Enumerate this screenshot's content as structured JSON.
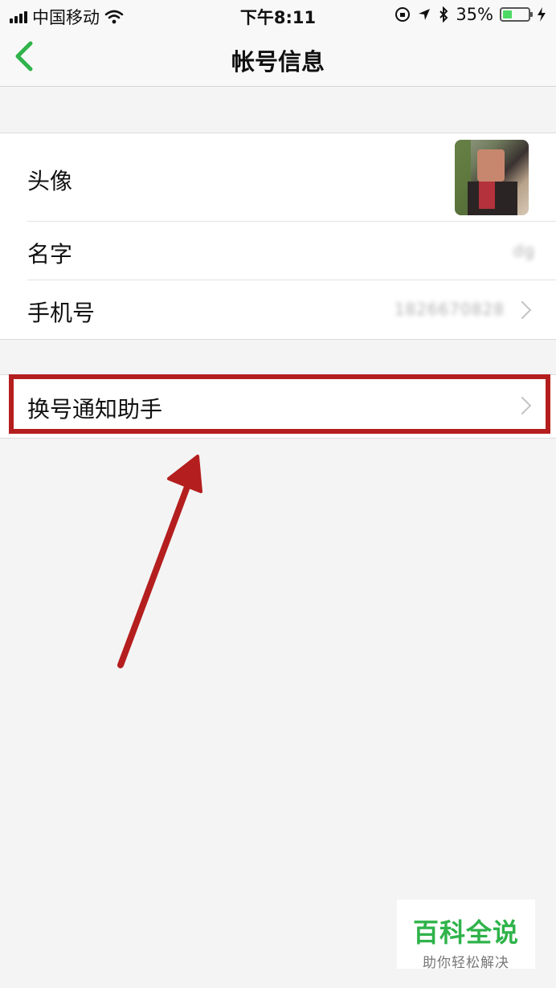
{
  "status_bar": {
    "carrier": "中国移动",
    "time": "下午8:11",
    "battery_percent": "35%",
    "battery_level": 0.35
  },
  "nav": {
    "title": "帐号信息"
  },
  "account": {
    "avatar_label": "头像",
    "name_label": "名字",
    "name_value": "dg",
    "phone_label": "手机号",
    "phone_value": "1826670828"
  },
  "assistant": {
    "label": "换号通知助手"
  },
  "watermark": {
    "title": "百科全说",
    "subtitle": "助你轻松解决"
  },
  "colors": {
    "accent_green": "#2fb34a",
    "highlight_red": "#b51e1e"
  }
}
